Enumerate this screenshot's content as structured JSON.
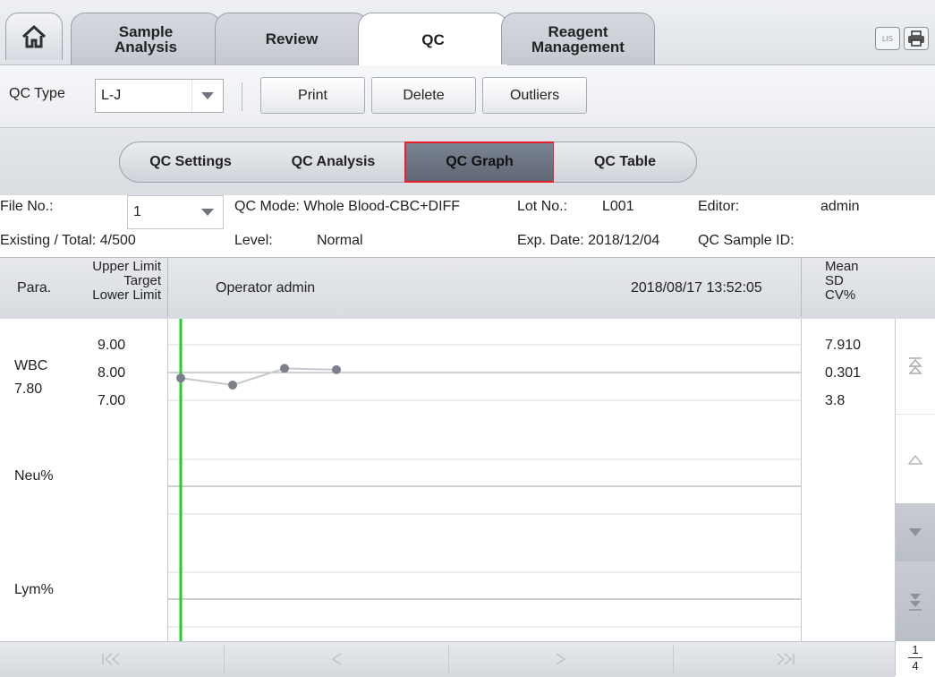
{
  "tabs": [
    "Sample\nAnalysis",
    "Review",
    "QC",
    "Reagent\nManagement"
  ],
  "tab_labels": {
    "sample_analysis_l1": "Sample",
    "sample_analysis_l2": "Analysis",
    "review": "Review",
    "qc": "QC",
    "reagent_l1": "Reagent",
    "reagent_l2": "Management"
  },
  "top_icons": {
    "lis": "LIS",
    "printer": "printer-icon"
  },
  "toolbar": {
    "qc_type_label": "QC Type",
    "qc_type_value": "L-J",
    "print": "Print",
    "delete": "Delete",
    "outliers": "Outliers"
  },
  "subtabs": {
    "settings": "QC Settings",
    "analysis": "QC Analysis",
    "graph": "QC Graph",
    "table": "QC Table"
  },
  "info": {
    "file_no_label": "File No.:",
    "file_no_value": "1",
    "qc_mode": "QC Mode: Whole Blood-CBC+DIFF",
    "lot_no_label": "Lot No.:",
    "lot_no_value": "L001",
    "editor_label": "Editor:",
    "editor_value": "admin",
    "existing": "Existing / Total: 4/500",
    "level_label": "Level:",
    "level_value": "Normal",
    "exp_date": "Exp. Date: 2018/12/04",
    "qc_sample_id": "QC Sample ID:"
  },
  "header": {
    "para": "Para.",
    "upper": "Upper Limit",
    "target": "Target",
    "lower": "Lower Limit",
    "operator": "Operator admin",
    "datetime": "2018/08/17   13:52:05",
    "mean": "Mean",
    "sd": "SD",
    "cv": "CV%"
  },
  "rows": [
    {
      "name": "WBC",
      "value": "7.80",
      "upper": "9.00",
      "target": "8.00",
      "lower": "7.00",
      "mean": "7.910",
      "sd": "0.301",
      "cv": "3.8"
    },
    {
      "name": "Neu%"
    },
    {
      "name": "Lym%"
    }
  ],
  "chart_data": {
    "type": "line",
    "series": [
      {
        "parameter": "WBC",
        "values": [
          7.8,
          7.55,
          8.15,
          8.1
        ],
        "upper": 9.0,
        "target": 8.0,
        "lower": 7.0
      }
    ]
  },
  "page": {
    "current": "1",
    "total": "4"
  },
  "colors": {
    "accent_selected": "#e8202a",
    "cursor": "#22cc33",
    "point": "#7b808a"
  }
}
